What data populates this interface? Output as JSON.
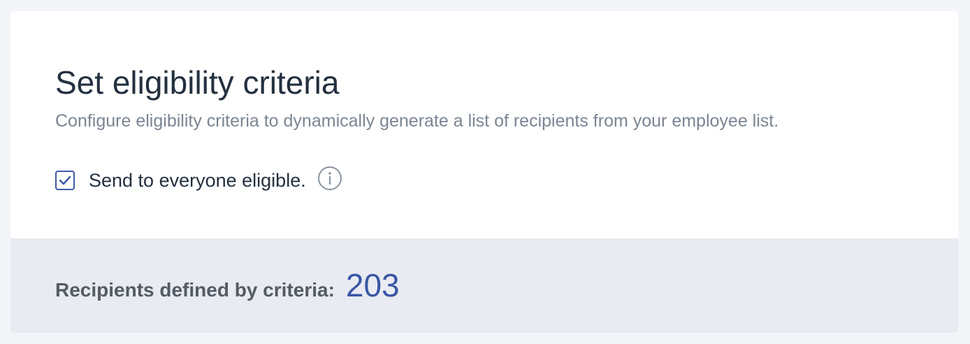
{
  "eligibility": {
    "title": "Set eligibility criteria",
    "description": "Configure eligibility criteria to dynamically generate a list of recipients from your employee list.",
    "send_to_everyone": {
      "label": "Send to everyone eligible.",
      "checked": true
    },
    "info_icon": "info-circle-icon"
  },
  "summary": {
    "label": "Recipients defined by criteria:",
    "count": "203"
  },
  "colors": {
    "accent": "#3a56a5",
    "title_text": "#23303f",
    "muted_text": "#7b8593",
    "footer_bg": "#e8ebf1",
    "page_bg": "#f4f5f9"
  }
}
